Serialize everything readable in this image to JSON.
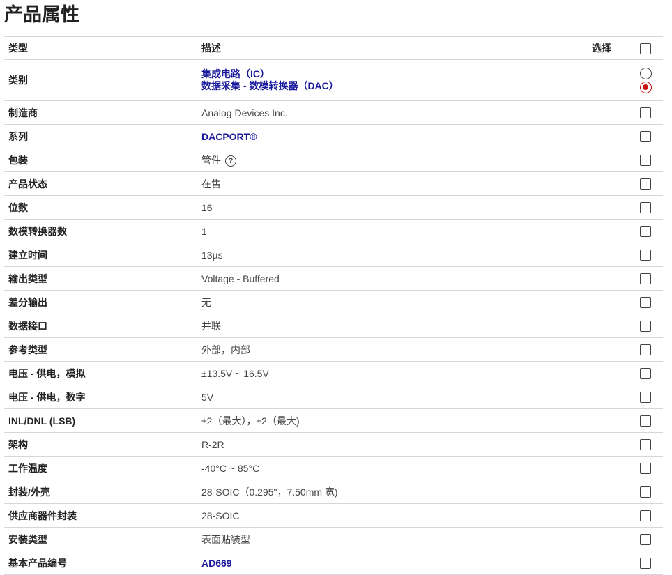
{
  "page_title": "产品属性",
  "header": {
    "type": "类型",
    "desc": "描述",
    "select": "选择"
  },
  "rows": [
    {
      "type": "类别",
      "lines": [
        "集成电路（IC）",
        "数据采集 - 数模转换器（DAC）"
      ],
      "link": true,
      "control": "radio"
    },
    {
      "type": "制造商",
      "desc": "Analog Devices Inc."
    },
    {
      "type": "系列",
      "desc": "DACPORT®",
      "link": true
    },
    {
      "type": "包装",
      "desc": "管件",
      "help_icon": "help-circle-icon"
    },
    {
      "type": "产品状态",
      "desc": "在售"
    },
    {
      "type": "位数",
      "desc": "16"
    },
    {
      "type": "数模转换器数",
      "desc": "1"
    },
    {
      "type": "建立时间",
      "desc": "13µs"
    },
    {
      "type": "输出类型",
      "desc": "Voltage - Buffered"
    },
    {
      "type": "差分输出",
      "desc": "无"
    },
    {
      "type": "数据接口",
      "desc": "并联"
    },
    {
      "type": "参考类型",
      "desc": "外部，内部"
    },
    {
      "type": "电压 - 供电，模拟",
      "desc": "±13.5V ~ 16.5V"
    },
    {
      "type": "电压 - 供电，数字",
      "desc": "5V"
    },
    {
      "type": "INL/DNL (LSB)",
      "desc": "±2（最大），±2（最大)"
    },
    {
      "type": "架构",
      "desc": "R-2R"
    },
    {
      "type": "工作温度",
      "desc": "-40°C ~ 85°C"
    },
    {
      "type": "封装/外壳",
      "desc": "28-SOIC（0.295\"，7.50mm 宽)"
    },
    {
      "type": "供应商器件封装",
      "desc": "28-SOIC"
    },
    {
      "type": "安装类型",
      "desc": "表面贴装型"
    },
    {
      "type": "基本产品编号",
      "desc": "AD669",
      "link": true
    }
  ],
  "colors": {
    "link": "#1a1a9c",
    "radio_selected": "#cc1111",
    "border": "#d6d6d6"
  }
}
